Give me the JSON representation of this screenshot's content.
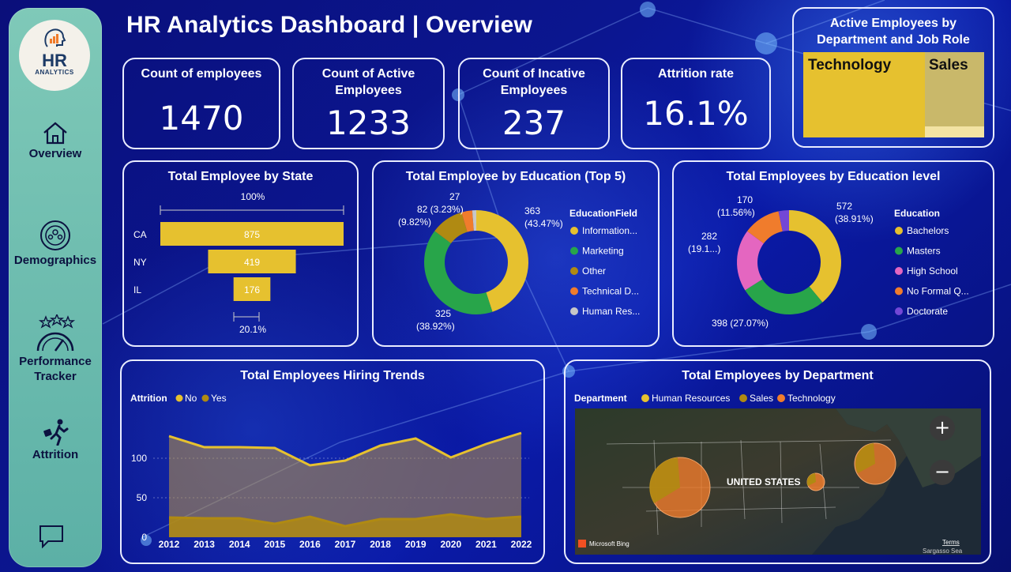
{
  "header": {
    "title": "HR Analytics Dashboard | Overview"
  },
  "sidebar": {
    "logo_text": "HR",
    "logo_sub": "ANALYTICS",
    "items": [
      {
        "label": "Overview",
        "icon": "home-icon"
      },
      {
        "label": "Demographics",
        "icon": "demographics-icon"
      },
      {
        "label": "Performance Tracker",
        "icon": "performance-gauge-icon"
      },
      {
        "label": "Attrition",
        "icon": "person-leaving-icon"
      }
    ],
    "chat_icon": "chat-icon"
  },
  "kpis": [
    {
      "label": "Count of employees",
      "value": "1470"
    },
    {
      "label": "Count of Active Employees",
      "value": "1233"
    },
    {
      "label": "Count of Incative Employees",
      "value": "237"
    },
    {
      "label": "Attrition rate",
      "value": "16.1%"
    }
  ],
  "treemap": {
    "title": "Active Employees by Department and Job Role",
    "tiles": [
      "Technology",
      "Sales"
    ]
  },
  "colors": {
    "yellow": "#e6c12f",
    "green": "#28a54a",
    "olive": "#b08a12",
    "orange": "#f07c2c",
    "gray": "#c7c7c7",
    "pink": "#e466c0",
    "purple": "#7347d6",
    "khaki": "#c9b86a"
  },
  "chart_data": [
    {
      "type": "bar",
      "title": "Total Employee by State",
      "categories": [
        "CA",
        "NY",
        "IL"
      ],
      "values": [
        875,
        419,
        176
      ],
      "top_label": "100%",
      "bottom_label": "20.1%"
    },
    {
      "type": "pie",
      "title": "Total Employee by Education (Top 5)",
      "legend_title": "EducationField",
      "legend": [
        "Information...",
        "Marketing",
        "Other",
        "Technical D...",
        "Human Res..."
      ],
      "values": [
        363,
        325,
        82,
        27,
        10
      ],
      "labels": [
        "363",
        "(43.47%)",
        "325",
        "(38.92%)",
        "82 (3.23%)",
        "(9.82%)",
        "27"
      ]
    },
    {
      "type": "pie",
      "title": "Total Employees by Education level",
      "legend_title": "Education",
      "legend": [
        "Bachelors",
        "Masters",
        "High School",
        "No Formal Q...",
        "Doctorate"
      ],
      "values": [
        572,
        398,
        282,
        170,
        48
      ],
      "labels": [
        "572",
        "(38.91%)",
        "398 (27.07%)",
        "282",
        "(19.1...)",
        "170",
        "(11.56%)"
      ]
    },
    {
      "type": "area",
      "title": "Total Employees Hiring Trends",
      "legend_title": "Attrition",
      "series": [
        {
          "name": "No",
          "values": [
            128,
            114,
            114,
            113,
            91,
            97,
            116,
            125,
            101,
            118,
            132
          ]
        },
        {
          "name": "Yes",
          "values": [
            25,
            24,
            24,
            17,
            26,
            14,
            23,
            23,
            29,
            23,
            26
          ]
        }
      ],
      "x": [
        "2012",
        "2013",
        "2014",
        "2015",
        "2016",
        "2017",
        "2018",
        "2019",
        "2020",
        "2021",
        "2022"
      ],
      "y_ticks": [
        "0",
        "50",
        "100"
      ],
      "ylim": [
        0,
        150
      ]
    }
  ],
  "map": {
    "title": "Total Employees by Department",
    "legend_title": "Department",
    "legend": [
      "Human Resources",
      "Sales",
      "Technology"
    ],
    "country_label": "UNITED STATES",
    "attribution": "Microsoft Bing",
    "terms": "Terms",
    "sea_label": "Sargasso Sea",
    "zoom_in": "+",
    "zoom_out": "−"
  }
}
